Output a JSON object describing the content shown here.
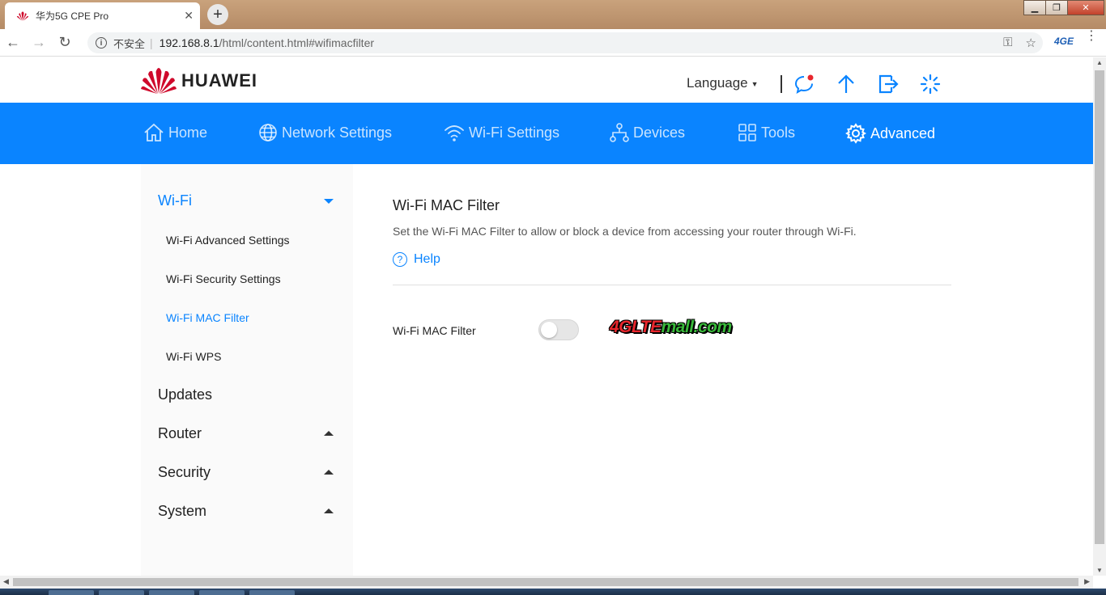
{
  "browser": {
    "tab_title": "华为5G CPE Pro",
    "tab_close": "✕",
    "new_tab": "+",
    "win_min": "▁",
    "win_max": "❐",
    "win_close": "✕",
    "nav_back": "←",
    "nav_forward": "→",
    "nav_reload": "↻",
    "security_label": "不安全",
    "separator": "|",
    "url_host": "192.168.8.1",
    "url_path": "/html/content.html#wifimacfilter",
    "key_icon_glyph": "⚿",
    "star_icon_glyph": "☆",
    "extension_label": "4GE",
    "menu_glyph": "⋮"
  },
  "header": {
    "brand": "HUAWEI",
    "language_label": "Language",
    "language_caret": "▼"
  },
  "nav": {
    "items": [
      {
        "label": "Home",
        "icon": "home-icon",
        "active": false
      },
      {
        "label": "Network Settings",
        "icon": "globe-icon",
        "active": false
      },
      {
        "label": "Wi-Fi Settings",
        "icon": "wifi-icon",
        "active": false
      },
      {
        "label": "Devices",
        "icon": "devices-icon",
        "active": false
      },
      {
        "label": "Tools",
        "icon": "tools-icon",
        "active": false
      },
      {
        "label": "Advanced",
        "icon": "gear-icon",
        "active": true
      }
    ]
  },
  "sidebar": {
    "wifi_group": "Wi-Fi",
    "wifi_items": [
      "Wi-Fi Advanced Settings",
      "Wi-Fi Security Settings",
      "Wi-Fi MAC Filter",
      "Wi-Fi WPS"
    ],
    "active_item": "Wi-Fi MAC Filter",
    "updates": "Updates",
    "router": "Router",
    "security": "Security",
    "system": "System"
  },
  "content": {
    "title": "Wi-Fi MAC Filter",
    "description": "Set the Wi-Fi MAC Filter to allow or block a device from accessing your router through Wi-Fi.",
    "help_glyph": "?",
    "help_label": "Help",
    "filter_label": "Wi-Fi MAC Filter",
    "filter_enabled": false
  },
  "watermark": {
    "part1": "4GLTE",
    "part2": "mall.com"
  },
  "colors": {
    "brand_blue": "#0a84ff",
    "huawei_red": "#cf0a2c"
  }
}
